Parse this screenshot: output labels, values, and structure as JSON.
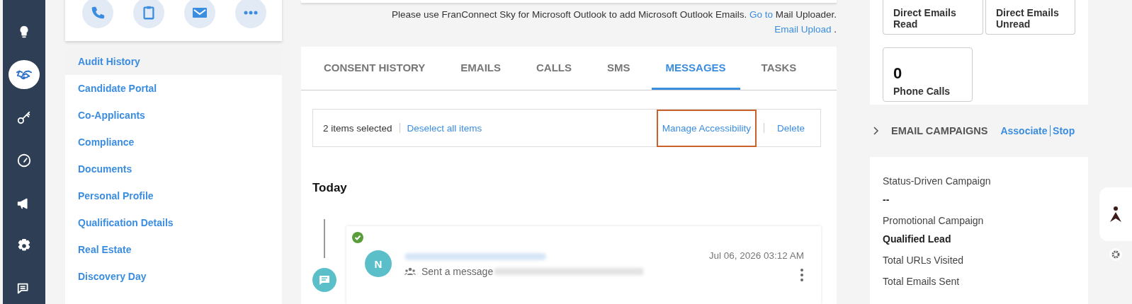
{
  "nav_rail": [
    {
      "selected": false
    },
    {
      "selected": true
    },
    {
      "selected": false
    },
    {
      "selected": false
    },
    {
      "selected": false
    },
    {
      "selected": false
    },
    {
      "selected": false
    }
  ],
  "side_menu": [
    {
      "label": "Audit History",
      "selected": true
    },
    {
      "label": "Candidate Portal",
      "selected": false
    },
    {
      "label": "Co-Applicants",
      "selected": false
    },
    {
      "label": "Compliance",
      "selected": false
    },
    {
      "label": "Documents",
      "selected": false
    },
    {
      "label": "Personal Profile",
      "selected": false
    },
    {
      "label": "Qualification Details",
      "selected": false
    },
    {
      "label": "Real Estate",
      "selected": false
    },
    {
      "label": "Discovery Day",
      "selected": false
    }
  ],
  "outlook_notice": {
    "text": "Please use FranConnect Sky for Microsoft Outlook to add Microsoft Outlook Emails.",
    "link": "Go to",
    "after": "Mail Uploader.",
    "second_link": "Email Upload",
    "end": "."
  },
  "tabs": [
    {
      "label": "CONSENT HISTORY",
      "selected": false
    },
    {
      "label": "EMAILS",
      "selected": false
    },
    {
      "label": "CALLS",
      "selected": false
    },
    {
      "label": "SMS",
      "selected": false
    },
    {
      "label": "MESSAGES",
      "selected": true
    },
    {
      "label": "TASKS",
      "selected": false
    }
  ],
  "selection_bar": {
    "count": "2 items selected",
    "deselect": "Deselect all items",
    "actions": [
      {
        "label": "Manage Accessibility",
        "highlighted": true
      },
      {
        "label": "Delete",
        "highlighted": false
      }
    ]
  },
  "timeline": {
    "heading": "Today",
    "messages": [
      {
        "checked": true,
        "avatar": "N",
        "action": "Sent a message",
        "date": "Jul 06, 2026 03:12 AM"
      }
    ]
  },
  "stats": [
    {
      "label": "Direct Emails Read"
    },
    {
      "label": "Direct Emails Unread"
    },
    {
      "value": "0",
      "label": "Phone Calls"
    }
  ],
  "email_campaigns": {
    "title": "EMAIL CAMPAIGNS",
    "expanded": false,
    "links": [
      "Associate",
      "Stop"
    ]
  },
  "campaign_fields": [
    {
      "label": "Status-Driven Campaign",
      "value": "--"
    },
    {
      "label": "Promotional Campaign",
      "value": "Qualified Lead"
    },
    {
      "label": "Total URLs Visited"
    },
    {
      "label": "Total Emails Sent"
    }
  ]
}
